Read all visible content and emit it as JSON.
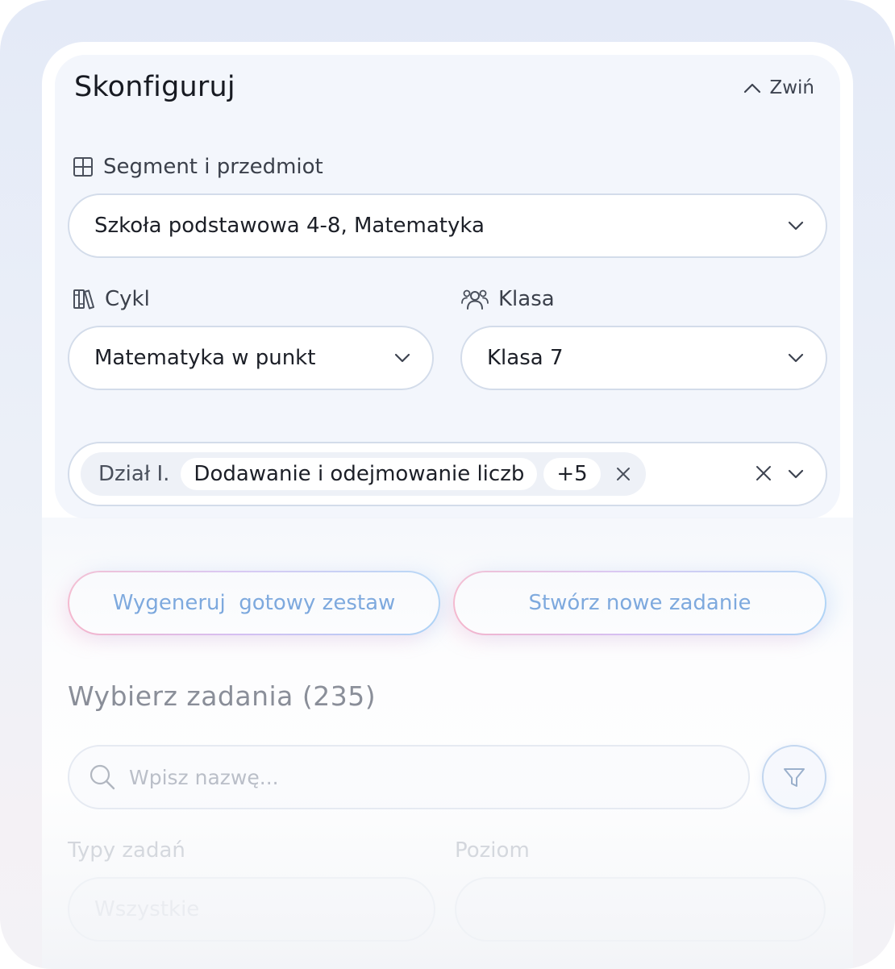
{
  "config": {
    "title": "Skonfiguruj",
    "collapse_label": "Zwiń",
    "segment": {
      "label": "Segment i przedmiot",
      "value": "Szkoła podstawowa 4-8, Matematyka"
    },
    "cycle": {
      "label": "Cykl",
      "value": "Matematyka w punkt"
    },
    "class": {
      "label": "Klasa",
      "value": "Klasa 7"
    },
    "section": {
      "prefix": "Dział I.",
      "chip": "Dodawanie i odejmowanie liczb",
      "more": "+5"
    }
  },
  "actions": {
    "generate_label": "Wygeneruj  gotowy zestaw",
    "create_label": "Stwórz nowe zadanie"
  },
  "tasks": {
    "title": "Wybierz zadania (235)",
    "search_placeholder": "Wpisz nazwę...",
    "types_label": "Typy zadań",
    "types_value": "Wszystkie",
    "level_label": "Poziom",
    "level_value": ""
  },
  "icons": {
    "segment": "grid-icon",
    "cycle": "books-icon",
    "class": "users-icon",
    "collapse": "chevron-up-icon",
    "dropdown": "chevron-down-icon",
    "clear": "close-icon",
    "search": "search-icon",
    "filter": "filter-icon"
  },
  "colors": {
    "accent_text": "#3d7fce",
    "gradient_pink": "#f59ab8",
    "gradient_blue": "#8dc4f4",
    "panel_bg": "#f3f6fc"
  }
}
